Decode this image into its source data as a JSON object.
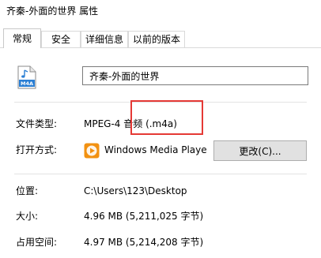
{
  "window": {
    "title": "齐秦-外面的世界 属性"
  },
  "tabs": [
    {
      "label": "常规",
      "active": true
    },
    {
      "label": "安全",
      "active": false
    },
    {
      "label": "详细信息",
      "active": false
    },
    {
      "label": "以前的版本",
      "active": false
    }
  ],
  "file": {
    "icon_text": "M4A",
    "icon": "audio-file-icon",
    "name": "齐秦-外面的世界"
  },
  "properties": {
    "type_label": "文件类型:",
    "type_value": "MPEG-4 音频 (.m4a)",
    "open_with_label": "打开方式:",
    "open_with_app": "Windows Media Playe",
    "open_with_icon": "media-player-icon",
    "change_button": "更改(C)...",
    "location_label": "位置:",
    "location_value": "C:\\Users\\123\\Desktop",
    "size_label": "大小:",
    "size_value": "4.96 MB (5,211,025 字节)",
    "disk_size_label": "占用空间:",
    "disk_size_value": "4.97 MB (5,214,208 字节)"
  },
  "colors": {
    "highlight": "#e53935",
    "icon_blue": "#2b7fd4",
    "player_orange": "#f29111"
  }
}
